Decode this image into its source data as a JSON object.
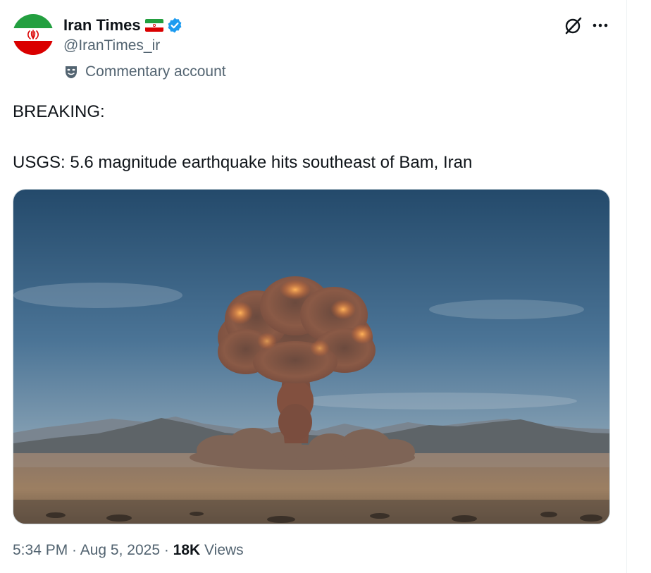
{
  "tweet": {
    "author": {
      "display_name": "Iran Times",
      "handle": "@IranTimes_ir",
      "flag_emoji": "iran-flag-icon",
      "verified_icon": "verified-badge-icon",
      "label_icon": "theater-mask-icon",
      "label": "Commentary account"
    },
    "actions": {
      "grok_icon": "grok-icon",
      "more_icon": "more-options-icon"
    },
    "text_lines": [
      "BREAKING:",
      "USGS: 5.6 magnitude earthquake hits southeast of Bam, Iran"
    ],
    "meta": {
      "time": "5:34 PM",
      "separator": " · ",
      "date": "Aug 5, 2025",
      "views_count": "18K",
      "views_label": " Views"
    }
  },
  "colors": {
    "text_primary": "#0f1419",
    "text_secondary": "#536471",
    "verified_blue": "#1d9bf0",
    "flag_green": "#239f40",
    "flag_red": "#da0000",
    "flag_emblem": "#da0000"
  }
}
